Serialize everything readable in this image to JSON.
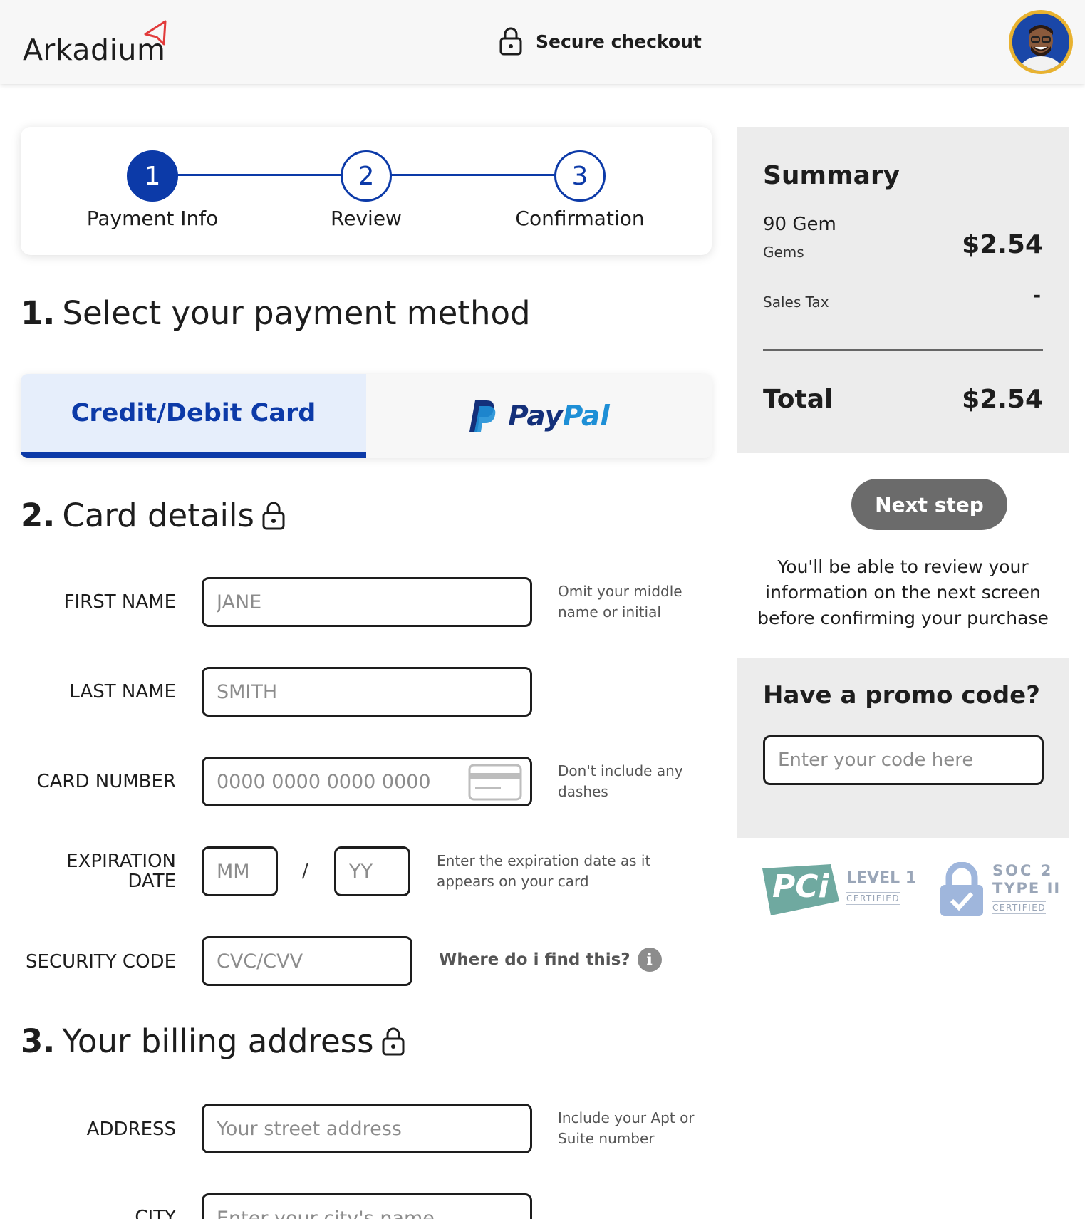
{
  "header": {
    "logo_text": "Arkadium",
    "secure_label": "Secure checkout"
  },
  "stepper": {
    "steps": [
      {
        "number": "1",
        "label": "Payment Info"
      },
      {
        "number": "2",
        "label": "Review"
      },
      {
        "number": "3",
        "label": "Confirmation"
      }
    ]
  },
  "sections": {
    "payment_num": "1.",
    "payment_title": "Select your payment method",
    "card_num": "2.",
    "card_title": "Card details",
    "billing_num": "3.",
    "billing_title": "Your billing address"
  },
  "tabs": {
    "card_label": "Credit/Debit Card",
    "paypal_pay": "Pay",
    "paypal_pal": "Pal"
  },
  "form": {
    "first_name": {
      "label": "FIRST NAME",
      "placeholder": "JANE",
      "hint": "Omit your middle name or initial"
    },
    "last_name": {
      "label": "LAST NAME",
      "placeholder": "SMITH"
    },
    "card_number": {
      "label": "CARD NUMBER",
      "placeholder": "0000 0000 0000 0000",
      "hint": "Don't include any dashes"
    },
    "expiration": {
      "label_line1": "EXPIRATION",
      "label_line2": "DATE",
      "month_placeholder": "MM",
      "separator": "/",
      "year_placeholder": "YY",
      "hint": "Enter the expiration date as it appears on your card"
    },
    "security_code": {
      "label": "SECURITY CODE",
      "placeholder": "CVC/CVV",
      "help_link": "Where do i find this?",
      "help_icon": "i"
    },
    "address": {
      "label": "ADDRESS",
      "placeholder": "Your street address",
      "hint": "Include your Apt or Suite number"
    },
    "city": {
      "label": "CITY",
      "placeholder": "Enter your city's name"
    }
  },
  "summary": {
    "title": "Summary",
    "item_name": "90 Gem",
    "item_sub": "Gems",
    "item_price": "$2.54",
    "tax_label": "Sales Tax",
    "tax_value": "-",
    "total_label": "Total",
    "total_value": "$2.54"
  },
  "next_button": "Next step",
  "review_note": "You'll be able to review your information on the next screen before confirming your purchase",
  "promo": {
    "title": "Have a promo code?",
    "placeholder": "Enter your code here"
  },
  "badges": {
    "pci_logo": "PCi",
    "pci_level": "LEVEL 1",
    "pci_cert": "CERTIFIED",
    "soc_line1": "SOC 2",
    "soc_line2": "TYPE II",
    "soc_cert": "CERTIFIED"
  },
  "colors": {
    "brand_blue": "#0c3aa8",
    "accent_red": "#e23b3b",
    "button_gray": "#6b6b6b",
    "panel_gray": "#ececec"
  }
}
